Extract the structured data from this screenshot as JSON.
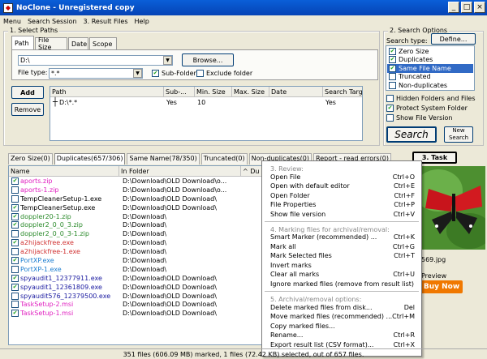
{
  "title": "NoClone - Unregistered copy",
  "menu": [
    "Menu",
    "Search Session",
    "3. Result Files",
    "Help"
  ],
  "select_paths": {
    "title": "1. Select Paths",
    "tabs": [
      "Path",
      "File Size",
      "Date",
      "Scope"
    ],
    "path_value": "D:\\",
    "browse_label": "Browse...",
    "file_type_label": "File type:",
    "file_type_value": "*.*",
    "subfolder_label": "Sub-Folder",
    "exclude_label": "Exclude folder",
    "add_label": "Add",
    "remove_label": "Remove",
    "columns": [
      "Path",
      "Sub-...",
      "Min. Size",
      "Max. Size",
      "Date",
      "Search Targ"
    ],
    "row": {
      "path": "D:\\*.*",
      "sub": "Yes",
      "min": "10",
      "max": "",
      "date": "",
      "target": "Yes"
    }
  },
  "search_options": {
    "title": "2. Search Options",
    "search_type_label": "Search type:",
    "define_label": "Define...",
    "types": [
      {
        "label": "Zero Size",
        "checked": true,
        "selected": false
      },
      {
        "label": "Duplicates",
        "checked": true,
        "selected": false
      },
      {
        "label": "Same File Name",
        "checked": true,
        "selected": true
      },
      {
        "label": "Truncated",
        "checked": false,
        "selected": false
      },
      {
        "label": "Non-duplicates",
        "checked": false,
        "selected": false
      }
    ],
    "hidden_label": "Hidden Folders and Files",
    "protect_label": "Protect System Folder",
    "show_version_label": "Show File Version",
    "search_label": "Search",
    "new_search_label": "New Search"
  },
  "task_label": "3. Task",
  "result_tabs": [
    "Zero Size(0)",
    "Duplicates(657/306)",
    "Same Name(78/350)",
    "Truncated(0)",
    "Non-duplicates(0)",
    "Report - read errors(0)"
  ],
  "result_columns": [
    "Name",
    "In Folder",
    "^ Du"
  ],
  "files": [
    {
      "name": "aports.zip",
      "folder": "D:\\Download\\OLD Download\\o...",
      "checked": true,
      "color": "#e020c0"
    },
    {
      "name": "aports-1.zip",
      "folder": "D:\\Download\\OLD Download\\o...",
      "checked": false,
      "color": "#e020c0"
    },
    {
      "name": "TempCleanerSetup-1.exe",
      "folder": "D:\\Download\\OLD Download\\",
      "checked": false,
      "color": "#000000"
    },
    {
      "name": "TempCleanerSetup.exe",
      "folder": "D:\\Download\\OLD Download\\",
      "checked": true,
      "color": "#000000"
    },
    {
      "name": "doppler20-1.zip",
      "folder": "D:\\Download\\",
      "checked": true,
      "color": "#2a8a2a"
    },
    {
      "name": "doppler2_0_0_3.zip",
      "folder": "D:\\Download\\",
      "checked": true,
      "color": "#2a8a2a"
    },
    {
      "name": "doppler2_0_0_3-1.zip",
      "folder": "D:\\Download\\",
      "checked": false,
      "color": "#2a8a2a"
    },
    {
      "name": "a2hijackfree.exe",
      "folder": "D:\\Download\\",
      "checked": true,
      "color": "#d03030"
    },
    {
      "name": "a2hijackfree-1.exe",
      "folder": "D:\\Download\\",
      "checked": false,
      "color": "#d03030"
    },
    {
      "name": "PortXP.exe",
      "folder": "D:\\Download\\",
      "checked": true,
      "color": "#1f7fd0"
    },
    {
      "name": "PortXP-1.exe",
      "folder": "D:\\Download\\",
      "checked": false,
      "color": "#1f7fd0"
    },
    {
      "name": "spyaudit1_12377911.exe",
      "folder": "D:\\Download\\OLD Download\\",
      "checked": true,
      "color": "#1a1aa0"
    },
    {
      "name": "spyaudit1_12361809.exe",
      "folder": "D:\\Download\\OLD Download\\",
      "checked": true,
      "color": "#1a1aa0"
    },
    {
      "name": "spyaudit576_12379500.exe",
      "folder": "D:\\Download\\OLD Download\\",
      "checked": false,
      "color": "#1a1aa0"
    },
    {
      "name": "TaskSetup-2.msi",
      "folder": "D:\\Download\\OLD Download\\",
      "checked": false,
      "color": "#e020c0"
    },
    {
      "name": "TaskSetup-1.msi",
      "folder": "D:\\Download\\OLD Download\\",
      "checked": true,
      "color": "#e020c0"
    }
  ],
  "context_menu": [
    {
      "type": "header",
      "label": "3. Review:"
    },
    {
      "type": "item",
      "label": "Open File",
      "key": "Ctrl+O"
    },
    {
      "type": "item",
      "label": "Open with default editor",
      "key": "Ctrl+E"
    },
    {
      "type": "item",
      "label": "Open Folder",
      "key": "Ctrl+F"
    },
    {
      "type": "item",
      "label": "File Properties",
      "key": "Ctrl+P"
    },
    {
      "type": "item",
      "label": "Show file version",
      "key": "Ctrl+V"
    },
    {
      "type": "sep"
    },
    {
      "type": "header",
      "label": "4. Marking files for archival/removal:"
    },
    {
      "type": "item",
      "label": "Smart Marker (recommended) ...",
      "key": "Ctrl+K"
    },
    {
      "type": "item",
      "label": "Mark all",
      "key": "Ctrl+G"
    },
    {
      "type": "item",
      "label": "Mark Selected files",
      "key": "Ctrl+T"
    },
    {
      "type": "item",
      "label": "Invert marks",
      "key": ""
    },
    {
      "type": "item",
      "label": "Clear all marks",
      "key": "Ctrl+U"
    },
    {
      "type": "item",
      "label": "Ignore marked files (remove from result list)",
      "key": ""
    },
    {
      "type": "sep"
    },
    {
      "type": "header",
      "label": "5. Archival/removal options:"
    },
    {
      "type": "item",
      "label": "Delete marked files from disk...",
      "key": "Del"
    },
    {
      "type": "item",
      "label": "Move marked files (recommended) ...",
      "key": "Ctrl+M"
    },
    {
      "type": "item",
      "label": "Copy marked files...",
      "key": ""
    },
    {
      "type": "item",
      "label": "Rename...",
      "key": "Ctrl+R"
    },
    {
      "type": "item",
      "label": "Export result list (CSV format)...",
      "key": "Ctrl+X"
    }
  ],
  "preview": {
    "filename": "569.jpg",
    "preview_label": "Preview",
    "buy_label": "Buy Now"
  },
  "status": "351 files (606.09 MB) marked, 1 files (72.42 KB) selected, out of 657 files.",
  "colors": {
    "title_bar": "#0543b5",
    "selection": "#316ac5",
    "buy_button": "#f07800"
  }
}
